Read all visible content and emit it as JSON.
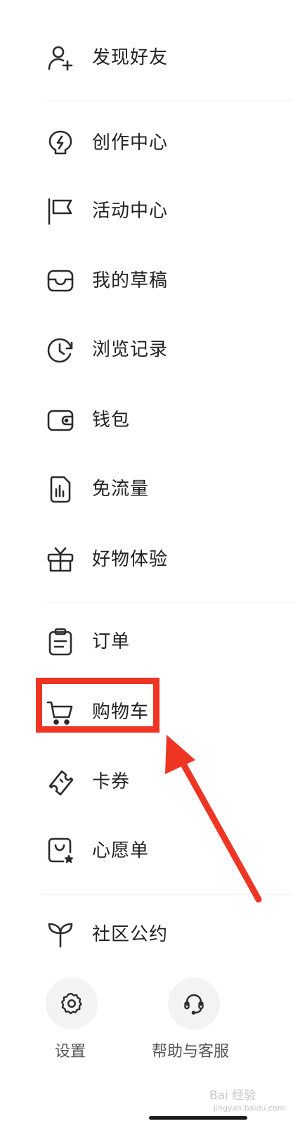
{
  "menu_items": [
    {
      "label": "发现好友",
      "icon": "add-friend-icon"
    },
    {
      "label": "创作中心",
      "icon": "bulb-lightning-icon"
    },
    {
      "label": "活动中心",
      "icon": "flag-icon"
    },
    {
      "label": "我的草稿",
      "icon": "inbox-icon"
    },
    {
      "label": "浏览记录",
      "icon": "history-clock-icon"
    },
    {
      "label": "钱包",
      "icon": "wallet-icon"
    },
    {
      "label": "免流量",
      "icon": "sim-card-icon"
    },
    {
      "label": "好物体验",
      "icon": "gift-icon"
    },
    {
      "label": "订单",
      "icon": "clipboard-icon"
    },
    {
      "label": "购物车",
      "icon": "cart-icon"
    },
    {
      "label": "卡券",
      "icon": "coupon-ticket-icon"
    },
    {
      "label": "心愿单",
      "icon": "wishlist-bag-icon"
    },
    {
      "label": "社区公约",
      "icon": "sprout-icon"
    }
  ],
  "bottom_actions": [
    {
      "label": "设置",
      "icon": "gear-icon"
    },
    {
      "label": "帮助与客服",
      "icon": "headset-icon"
    }
  ],
  "annotation": {
    "highlight_color": "#ee3524"
  },
  "watermark": {
    "text": "Bai 经验",
    "sub": "jingyan.baidu.com"
  },
  "colors": {
    "text": "#222222",
    "icon": "#2b2b2b",
    "divider": "#ececec",
    "button_bg": "#f3f3f3"
  }
}
